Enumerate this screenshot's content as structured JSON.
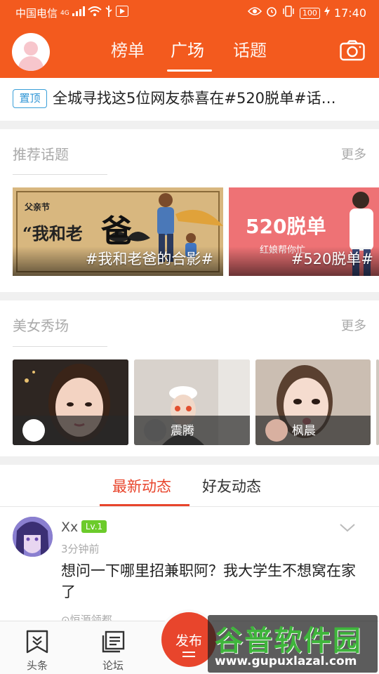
{
  "status_bar": {
    "carrier": "中国电信",
    "network": "4G",
    "battery": "100",
    "time": "17:40"
  },
  "header": {
    "tabs": [
      {
        "label": "榜单",
        "active": false
      },
      {
        "label": "广场",
        "active": true
      },
      {
        "label": "话题",
        "active": false
      }
    ],
    "accent_color": "#f35a1e"
  },
  "pinned": {
    "badge": "置顶",
    "text": "全城寻找这5位网友恭喜在#520脱单#话…"
  },
  "recommended_topics": {
    "title": "推荐话题",
    "more": "更多",
    "cards": [
      {
        "label": "#我和老爸的合影#",
        "art_line1": "父亲节",
        "art_line2": "“我和老",
        "art_big": "爸"
      },
      {
        "label": "#520脱单#",
        "art_line1": "520脱单",
        "art_line2": "红娘帮你忙"
      }
    ]
  },
  "beauty_show": {
    "title": "美女秀场",
    "more": "更多",
    "cards": [
      {
        "name": ""
      },
      {
        "name": "震腾"
      },
      {
        "name": "枫晨"
      }
    ]
  },
  "feed": {
    "tabs": [
      {
        "label": "最新动态",
        "active": true
      },
      {
        "label": "好友动态",
        "active": false
      }
    ],
    "post": {
      "author": "Xx",
      "level": "Lv.1",
      "time": "3分钟前",
      "text": "想问一下哪里招兼职阿？我大学生不想窝在家了",
      "location": "恒源领都"
    }
  },
  "bottom_nav": {
    "items": [
      {
        "label": "头条"
      },
      {
        "label": "论坛"
      }
    ],
    "publish": "发布"
  },
  "watermark": {
    "title": "谷普软件园",
    "url": "www.gupuxlazal.com"
  }
}
